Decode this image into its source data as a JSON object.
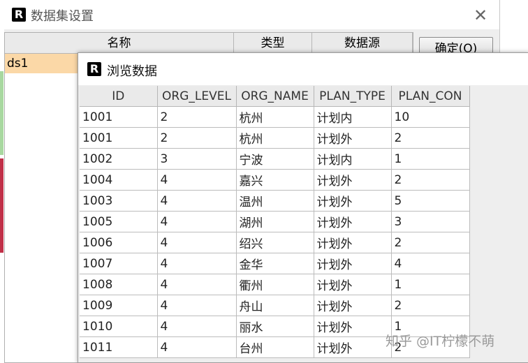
{
  "outer_dialog": {
    "icon": "R",
    "title": "数据集设置",
    "close": "✕",
    "columns": [
      "名称",
      "类型",
      "数据源"
    ],
    "rows": [
      {
        "name": "ds1"
      }
    ],
    "confirm_label": "确定(O)"
  },
  "preview_dialog": {
    "icon": "R",
    "title": "浏览数据",
    "columns": [
      "ID",
      "ORG_LEVEL",
      "ORG_NAME",
      "PLAN_TYPE",
      "PLAN_CON"
    ],
    "rows": [
      [
        "1001",
        "2",
        "杭州",
        "计划内",
        "10"
      ],
      [
        "1001",
        "2",
        "杭州",
        "计划外",
        "2"
      ],
      [
        "1002",
        "3",
        "宁波",
        "计划内",
        "1"
      ],
      [
        "1004",
        "4",
        "嘉兴",
        "计划外",
        "2"
      ],
      [
        "1003",
        "4",
        "温州",
        "计划外",
        "5"
      ],
      [
        "1005",
        "4",
        "湖州",
        "计划外",
        "3"
      ],
      [
        "1006",
        "4",
        "绍兴",
        "计划外",
        "2"
      ],
      [
        "1007",
        "4",
        "金华",
        "计划外",
        "4"
      ],
      [
        "1008",
        "4",
        "衢州",
        "计划外",
        "1"
      ],
      [
        "1009",
        "4",
        "舟山",
        "计划外",
        "2"
      ],
      [
        "1010",
        "4",
        "丽水",
        "计划外",
        "1"
      ],
      [
        "1011",
        "4",
        "台州",
        "计划外",
        "2"
      ]
    ]
  },
  "watermark": "知乎 @IT柠檬不萌"
}
